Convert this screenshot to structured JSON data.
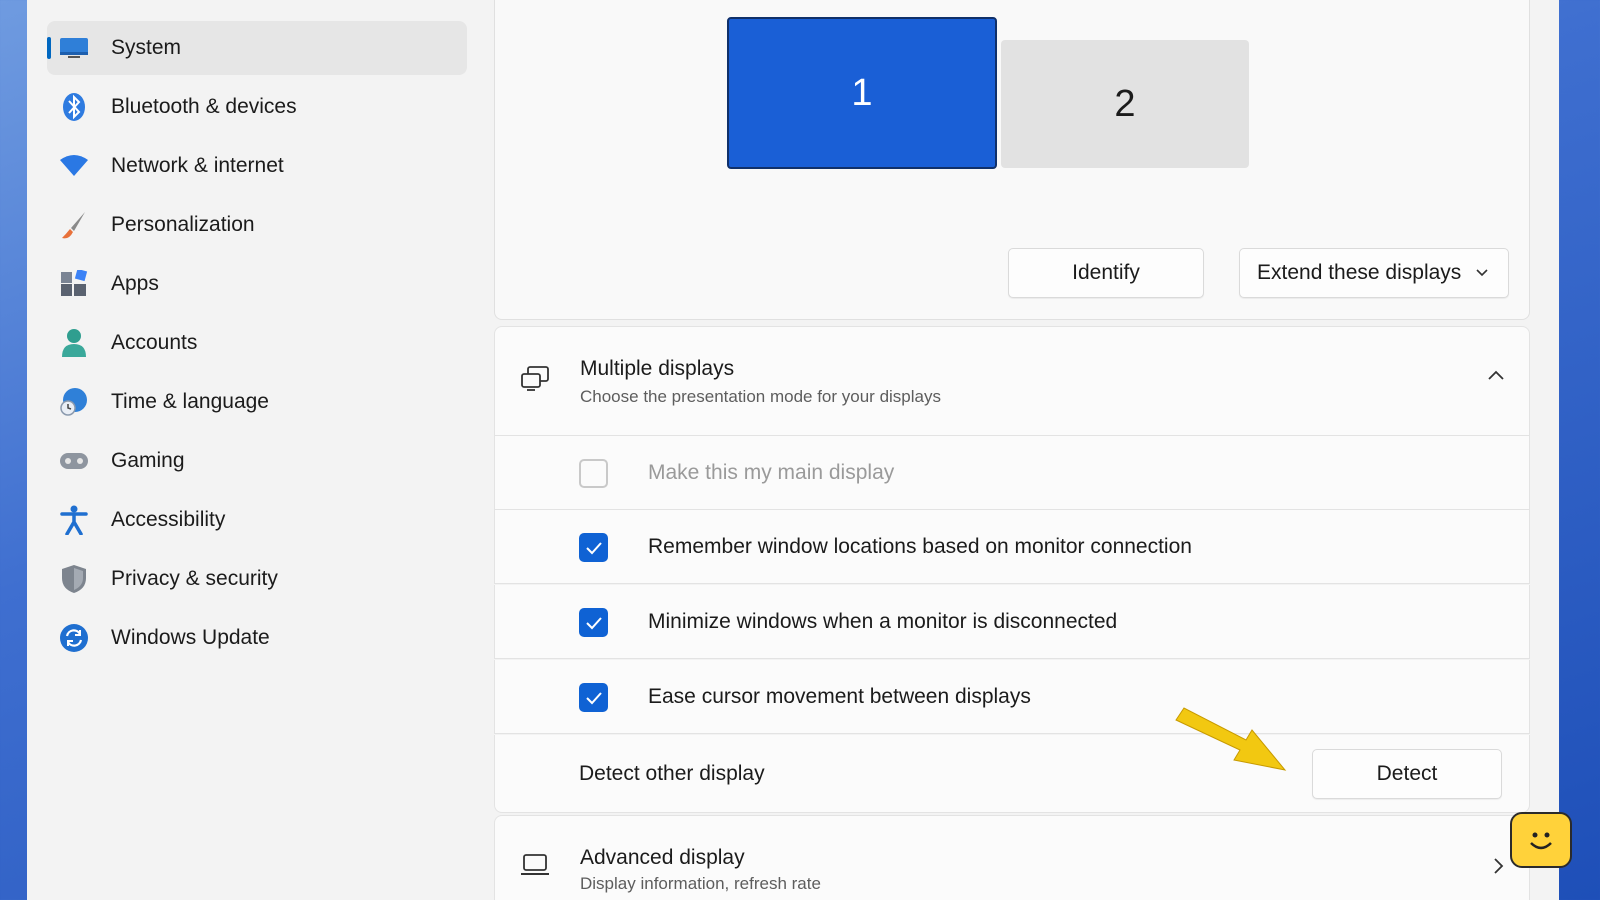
{
  "sidebar": {
    "items": [
      {
        "label": "System",
        "icon": "monitor-icon",
        "active": true
      },
      {
        "label": "Bluetooth & devices",
        "icon": "bluetooth-icon"
      },
      {
        "label": "Network & internet",
        "icon": "wifi-icon"
      },
      {
        "label": "Personalization",
        "icon": "brush-icon"
      },
      {
        "label": "Apps",
        "icon": "apps-icon"
      },
      {
        "label": "Accounts",
        "icon": "person-icon"
      },
      {
        "label": "Time & language",
        "icon": "globe-clock-icon"
      },
      {
        "label": "Gaming",
        "icon": "controller-icon"
      },
      {
        "label": "Accessibility",
        "icon": "accessibility-icon"
      },
      {
        "label": "Privacy & security",
        "icon": "shield-icon"
      },
      {
        "label": "Windows Update",
        "icon": "update-icon"
      }
    ]
  },
  "arrangement": {
    "monitors": [
      "1",
      "2"
    ],
    "identify_label": "Identify",
    "mode_value": "Extend these displays"
  },
  "multiple_displays": {
    "title": "Multiple displays",
    "subtitle": "Choose the presentation mode for your displays",
    "options": [
      {
        "label": "Make this my main display",
        "checked": false,
        "disabled": true
      },
      {
        "label": "Remember window locations based on monitor connection",
        "checked": true
      },
      {
        "label": "Minimize windows when a monitor is disconnected",
        "checked": true
      },
      {
        "label": "Ease cursor movement between displays",
        "checked": true
      }
    ],
    "detect_label": "Detect other display",
    "detect_button": "Detect"
  },
  "advanced_display": {
    "title": "Advanced display",
    "subtitle": "Display information, refresh rate"
  },
  "colors": {
    "accent": "#0f62d4",
    "annotation_arrow": "#f2c811"
  }
}
